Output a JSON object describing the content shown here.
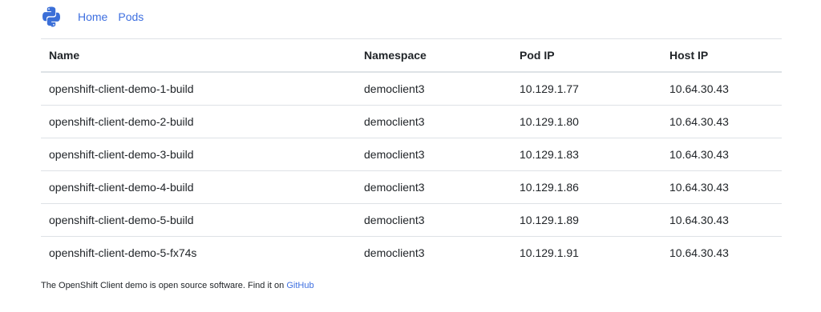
{
  "nav": {
    "logo_icon": "python-logo-icon",
    "links": [
      "Home",
      "Pods"
    ],
    "link_color": "#3e6fe0"
  },
  "table": {
    "headers": [
      "Name",
      "Namespace",
      "Pod IP",
      "Host IP"
    ],
    "rows": [
      [
        "openshift-client-demo-1-build",
        "democlient3",
        "10.129.1.77",
        "10.64.30.43"
      ],
      [
        "openshift-client-demo-2-build",
        "democlient3",
        "10.129.1.80",
        "10.64.30.43"
      ],
      [
        "openshift-client-demo-3-build",
        "democlient3",
        "10.129.1.83",
        "10.64.30.43"
      ],
      [
        "openshift-client-demo-4-build",
        "democlient3",
        "10.129.1.86",
        "10.64.30.43"
      ],
      [
        "openshift-client-demo-5-build",
        "democlient3",
        "10.129.1.89",
        "10.64.30.43"
      ],
      [
        "openshift-client-demo-5-fx74s",
        "democlient3",
        "10.129.1.91",
        "10.64.30.43"
      ]
    ]
  },
  "footer": {
    "text": "The OpenShift Client demo is open source software. Find it on ",
    "link": "GitHub"
  }
}
